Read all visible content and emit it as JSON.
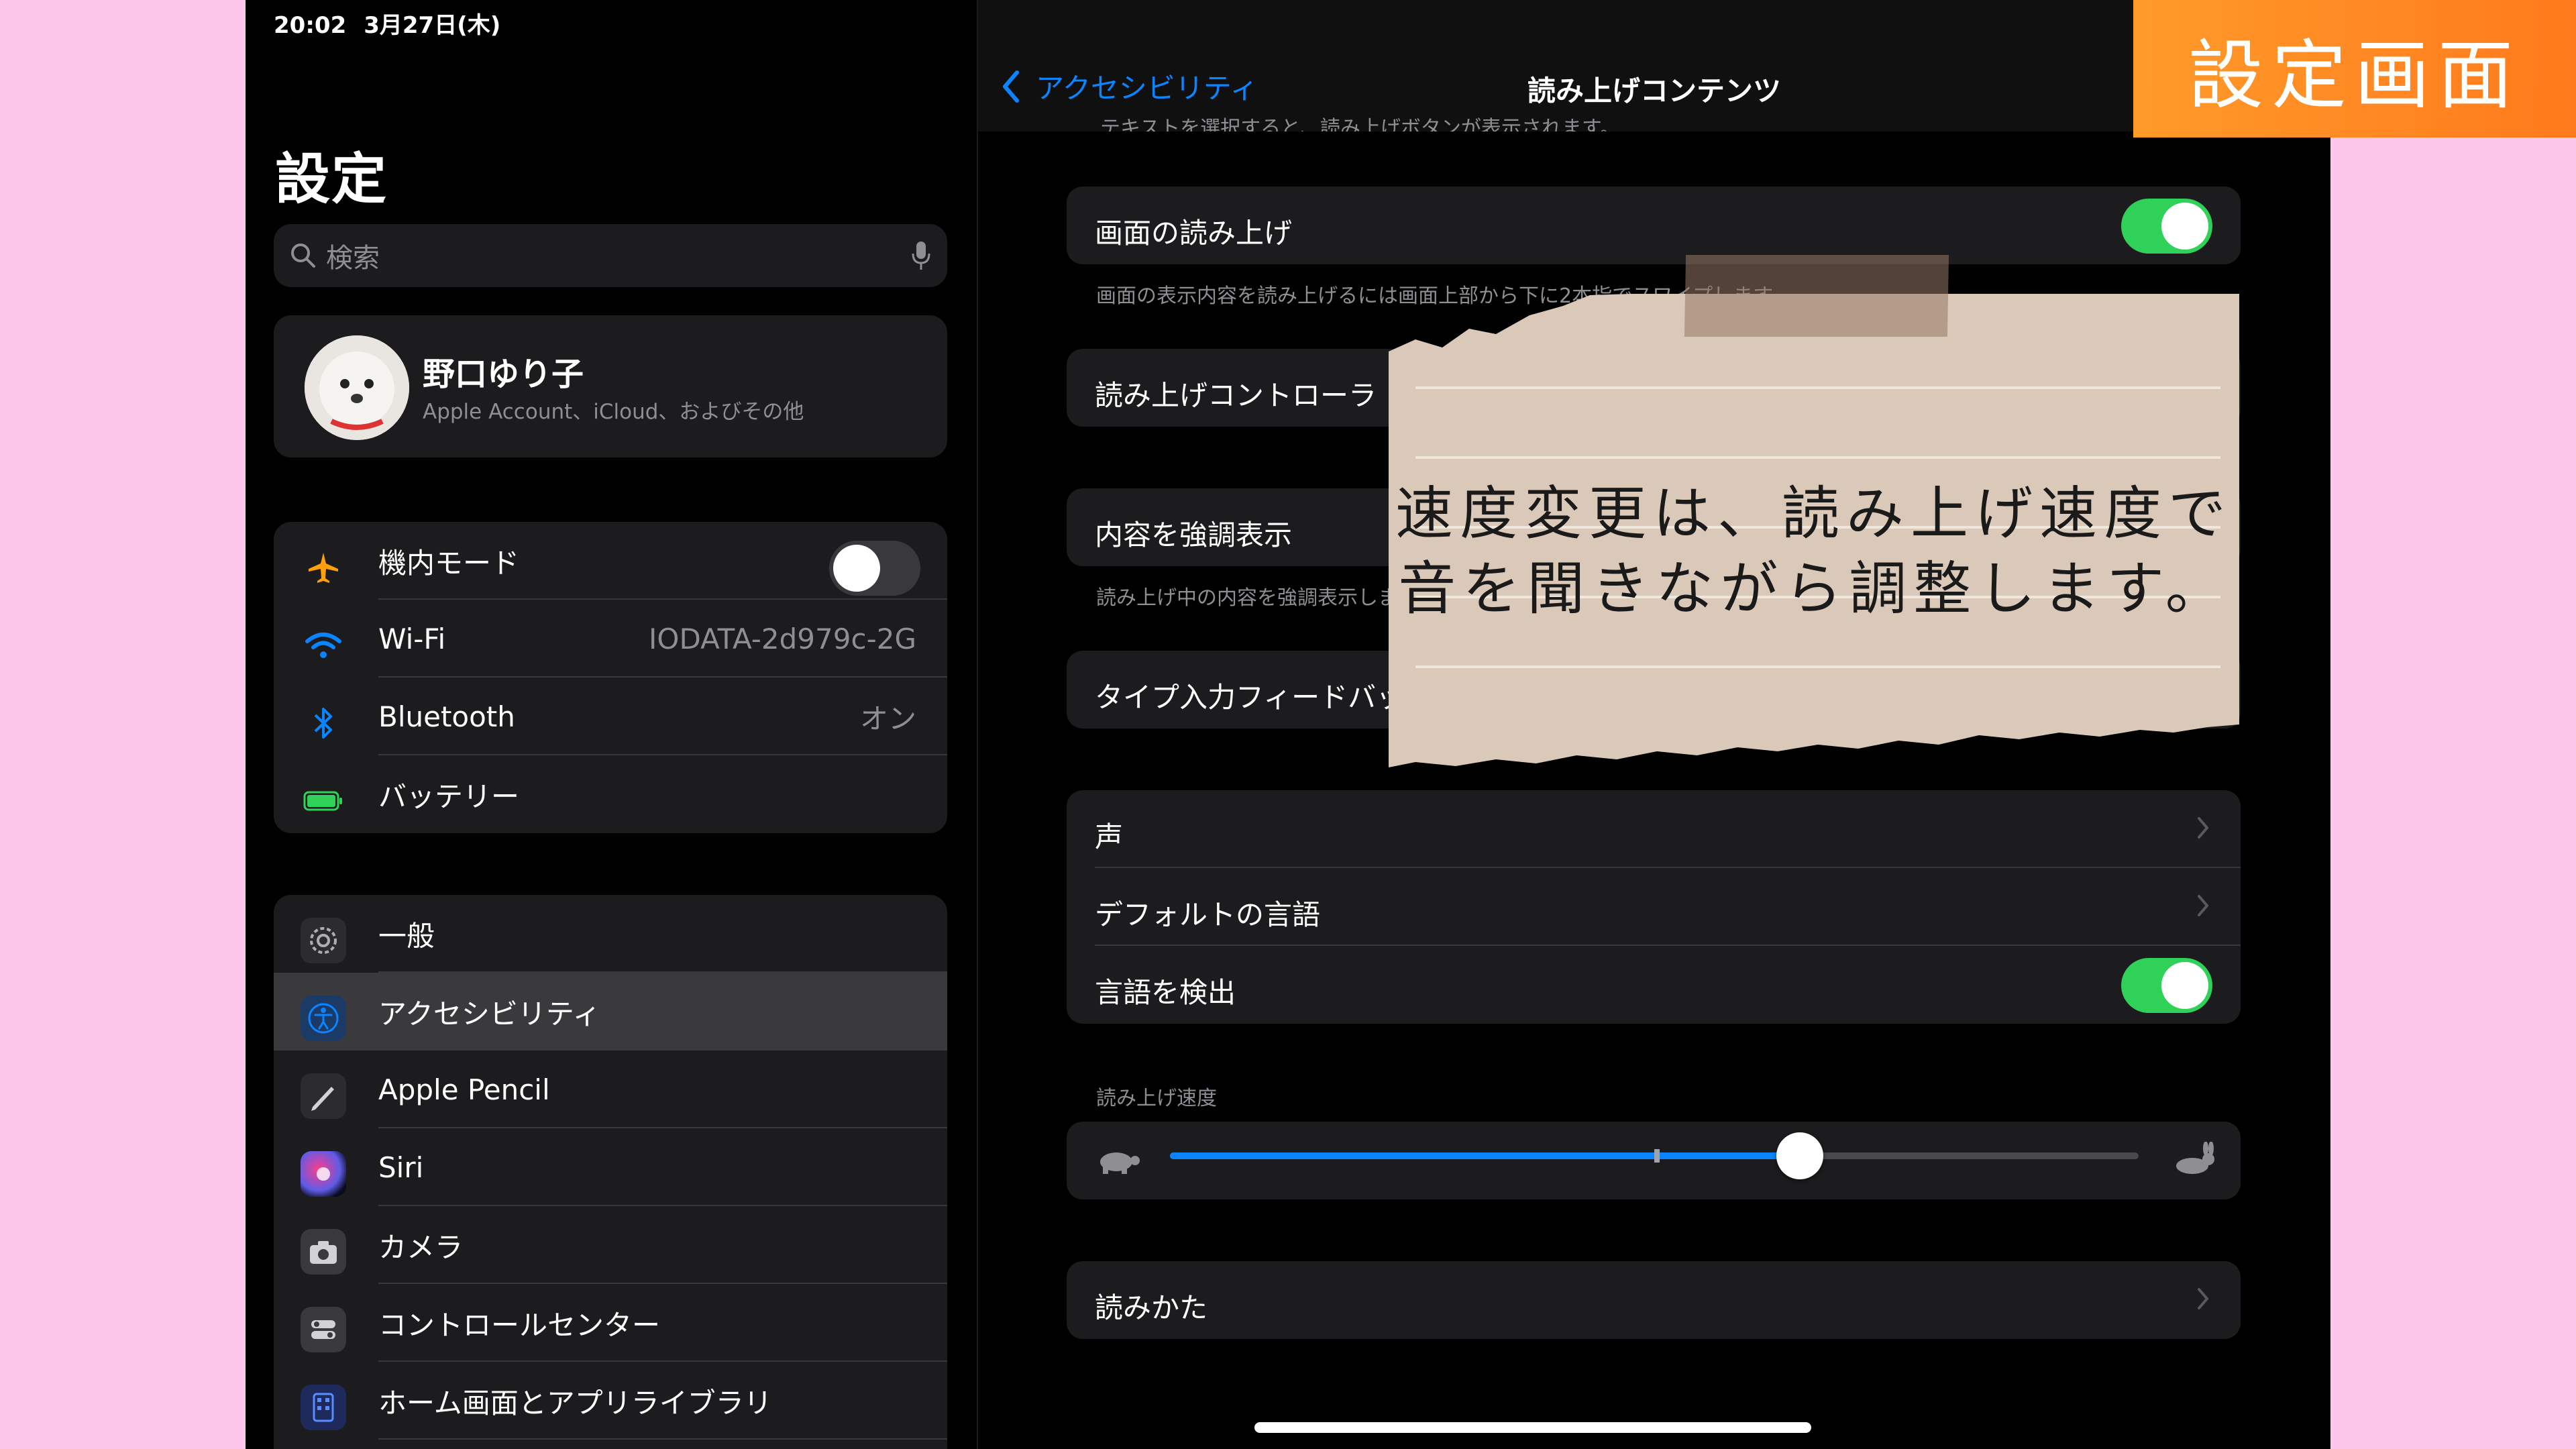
{
  "status": {
    "time": "20:02",
    "date": "3月27日(木)"
  },
  "sidebar": {
    "title": "設定",
    "search_placeholder": "検索",
    "profile": {
      "name": "野口ゆり子",
      "subtitle": "Apple Account、iCloud、およびその他"
    },
    "group1": [
      {
        "label": "機内モード",
        "toggle": false
      },
      {
        "label": "Wi-Fi",
        "value": "IODATA-2d979c-2G"
      },
      {
        "label": "Bluetooth",
        "value": "オン"
      },
      {
        "label": "バッテリー"
      }
    ],
    "group2": [
      {
        "label": "一般"
      },
      {
        "label": "アクセシビリティ",
        "selected": true
      },
      {
        "label": "Apple Pencil"
      },
      {
        "label": "Siri"
      },
      {
        "label": "カメラ"
      },
      {
        "label": "コントロールセンター"
      },
      {
        "label": "ホーム画面とアプリライブラリ"
      }
    ]
  },
  "detail": {
    "back_label": "アクセシビリティ",
    "title": "読み上げコンテンツ",
    "clipped_text": "テキストを選択すると、読み上げボタンが表示されます。",
    "speak_screen": {
      "label": "画面の読み上げ",
      "toggle": true,
      "footer": "画面の表示内容を読み上げるには画面上部から下に2本指でスワイプします。"
    },
    "controller": {
      "label": "読み上げコントローラ"
    },
    "highlight": {
      "label": "内容を強調表示",
      "footer": "読み上げ中の内容を強調表示します。"
    },
    "typing": {
      "label": "タイプ入力フィードバック"
    },
    "voice_group": [
      {
        "label": "声"
      },
      {
        "label": "デフォルトの言語"
      },
      {
        "label": "言語を検出",
        "toggle": true
      }
    ],
    "rate": {
      "header": "読み上げ速度",
      "value_fraction": 0.65
    },
    "pronunciation": {
      "label": "読みかた"
    }
  },
  "overlay": {
    "note_line1": "速度変更は、読み上げ速度で",
    "note_line2": "音を聞きながら調整します。",
    "label": "設定画面"
  },
  "colors": {
    "accent": "#0a84ff",
    "toggle_on": "#30d158",
    "background": "#fbc6ea",
    "label_orange": "#ff8a22"
  }
}
